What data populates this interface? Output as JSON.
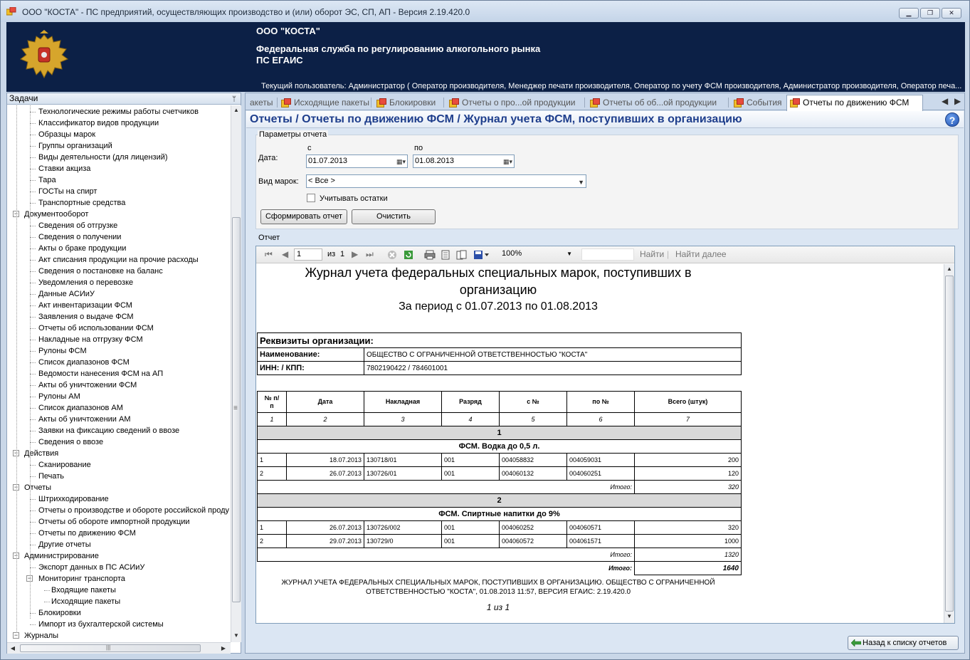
{
  "window": {
    "title": "ООО \"КОСТА\" - ПС предприятий, осуществляющих производство и (или) оборот ЭС, СП, АП - Версия 2.19.420.0",
    "minimize": "▁",
    "maximize": "❐",
    "close": "✕"
  },
  "banner": {
    "org": "ООО \"КОСТА\"",
    "agency_line1": "Федеральная служба по регулированию алкогольного рынка",
    "agency_line2": "ПС ЕГАИС",
    "current_user": "Текущий пользователь: Администратор ( Оператор производителя, Менеджер печати производителя, Оператор по учету ФСМ производителя, Администратор производителя, Оператор печа..."
  },
  "tasks_panel": {
    "title": "Задачи",
    "pin": "ᛘ",
    "items": [
      {
        "label": "Технологические режимы работы счетчиков",
        "level": 2
      },
      {
        "label": "Классификатор видов продукции",
        "level": 2
      },
      {
        "label": "Образцы марок",
        "level": 2
      },
      {
        "label": "Группы организаций",
        "level": 2
      },
      {
        "label": "Виды деятельности (для лицензий)",
        "level": 2
      },
      {
        "label": "Ставки акциза",
        "level": 2
      },
      {
        "label": "Тара",
        "level": 2
      },
      {
        "label": "ГОСТы на спирт",
        "level": 2
      },
      {
        "label": "Транспортные средства",
        "level": 2
      },
      {
        "label": "Документооборот",
        "level": 1
      },
      {
        "label": "Сведения об отгрузке",
        "level": 2
      },
      {
        "label": "Сведения о получении",
        "level": 2
      },
      {
        "label": "Акты о браке продукции",
        "level": 2
      },
      {
        "label": "Акт списания продукции на прочие расходы",
        "level": 2
      },
      {
        "label": "Сведения о постановке на баланс",
        "level": 2
      },
      {
        "label": "Уведомления о перевозке",
        "level": 2
      },
      {
        "label": "Данные АСИиУ",
        "level": 2
      },
      {
        "label": "Акт инвентаризации ФСМ",
        "level": 2
      },
      {
        "label": "Заявления о выдаче ФСМ",
        "level": 2
      },
      {
        "label": "Отчеты об использовании ФСМ",
        "level": 2
      },
      {
        "label": "Накладные на отгрузку ФСМ",
        "level": 2
      },
      {
        "label": "Рулоны ФСМ",
        "level": 2
      },
      {
        "label": "Список диапазонов ФСМ",
        "level": 2
      },
      {
        "label": "Ведомости нанесения ФСМ на АП",
        "level": 2
      },
      {
        "label": "Акты об уничтожении ФСМ",
        "level": 2
      },
      {
        "label": "Рулоны АМ",
        "level": 2
      },
      {
        "label": "Список диапазонов АМ",
        "level": 2
      },
      {
        "label": "Акты об уничтожении АМ",
        "level": 2
      },
      {
        "label": "Заявки на фиксацию сведений о ввозе",
        "level": 2
      },
      {
        "label": "Сведения о ввозе",
        "level": 2
      },
      {
        "label": "Действия",
        "level": 1
      },
      {
        "label": "Сканирование",
        "level": 2
      },
      {
        "label": "Печать",
        "level": 2
      },
      {
        "label": "Отчеты",
        "level": 1
      },
      {
        "label": "Штрихкодирование",
        "level": 2
      },
      {
        "label": "Отчеты о производстве и обороте российской проду",
        "level": 2
      },
      {
        "label": "Отчеты об обороте импортной продукции",
        "level": 2
      },
      {
        "label": "Отчеты по движению ФСМ",
        "level": 2
      },
      {
        "label": "Другие отчеты",
        "level": 2
      },
      {
        "label": "Администрирование",
        "level": 1
      },
      {
        "label": "Экспорт данных в ПС АСИиУ",
        "level": 2
      },
      {
        "label": "Мониторинг транспорта",
        "level": 2,
        "expandable": true
      },
      {
        "label": "Входящие пакеты",
        "level": 3
      },
      {
        "label": "Исходящие пакеты",
        "level": 3
      },
      {
        "label": "Блокировки",
        "level": 2
      },
      {
        "label": "Импорт из бухгалтерской системы",
        "level": 2
      },
      {
        "label": "Журналы",
        "level": 1
      }
    ],
    "scroll_grip": "≡",
    "hscroll_grip": "|||"
  },
  "tabs": [
    {
      "label": "акеты",
      "icon": false
    },
    {
      "label": "Исходящие пакеты",
      "icon": true
    },
    {
      "label": "Блокировки",
      "icon": true
    },
    {
      "label": "Отчеты о про...ой продукции",
      "icon": true
    },
    {
      "label": "Отчеты об об...ой продукции",
      "icon": true
    },
    {
      "label": "События",
      "icon": true
    },
    {
      "label": "Отчеты по движению ФСМ",
      "icon": true,
      "active": true
    }
  ],
  "tab_nav": {
    "prev": "◀",
    "next": "▶"
  },
  "page": {
    "title": "Отчеты / Отчеты по движению ФСМ / Журнал учета ФСМ, поступивших в организацию",
    "help": "?"
  },
  "params": {
    "group_label": "Параметры отчета",
    "date_label": "Дата:",
    "from_label": "с",
    "to_label": "по",
    "from_value": "01.07.2013",
    "to_value": "01.08.2013",
    "mark_type_label": "Вид марок:",
    "mark_type_value": "< Все >",
    "balance_label": "Учитывать остатки",
    "balance_checked": false,
    "build_button": "Сформировать отчет",
    "clear_button": "Очистить"
  },
  "report_group_label": "Отчет",
  "viewer_toolbar": {
    "first": "⏮",
    "prev": "◀",
    "page": "1",
    "of_label": "из",
    "total": "1",
    "next": "▶",
    "last": "⏭",
    "zoom": "100%",
    "find": "Найти",
    "sep": "|",
    "find_next": "Найти далее"
  },
  "report": {
    "title": "Журнал учета федеральных специальных марок, поступивших в организацию",
    "period": "За период с 01.07.2013 по 01.08.2013",
    "org_section": "Реквизиты организации:",
    "name_label": "Наименование:",
    "name_value": "ОБЩЕСТВО С ОГРАНИЧЕННОЙ ОТВЕТСТВЕННОСТЬЮ \"КОСТА\"",
    "inn_label": "ИНН: / КПП:",
    "inn_value": "7802190422 / 784601001",
    "columns": [
      "№ п/п",
      "Дата",
      "Накладная",
      "Разряд",
      "с №",
      "по №",
      "Всего (штук)"
    ],
    "col_numbers": [
      "1",
      "2",
      "3",
      "4",
      "5",
      "6",
      "7"
    ],
    "groups": [
      {
        "number": "1",
        "name": "ФСМ. Водка до 0,5 л.",
        "rows": [
          [
            "1",
            "18.07.2013",
            "130718/01",
            "001",
            "004058832",
            "004059031",
            "200"
          ],
          [
            "2",
            "26.07.2013",
            "130726/01",
            "001",
            "004060132",
            "004060251",
            "120"
          ]
        ],
        "subtotal_label": "Итого:",
        "subtotal": "320"
      },
      {
        "number": "2",
        "name": "ФСМ. Спиртные напитки до 9%",
        "rows": [
          [
            "1",
            "26.07.2013",
            "130726/002",
            "001",
            "004060252",
            "004060571",
            "320"
          ],
          [
            "2",
            "29.07.2013",
            "130729/0",
            "001",
            "004060572",
            "004061571",
            "1000"
          ]
        ],
        "subtotal_label": "Итого:",
        "subtotal": "1320"
      }
    ],
    "total_label": "Итого:",
    "total": "1640",
    "footer": "ЖУРНАЛ УЧЕТА ФЕДЕРАЛЬНЫХ СПЕЦИАЛЬНЫХ МАРОК, ПОСТУПИВШИХ В ОРГАНИЗАЦИЮ. ОБЩЕСТВО С ОГРАНИЧЕННОЙ ОТВЕТСТВЕННОСТЬЮ \"КОСТА\", 01.08.2013 11:57, ВЕРСИЯ ЕГАИС: 2.19.420.0",
    "page_info": "1 из 1"
  },
  "back_button": "Назад к списку отчетов",
  "colors": {
    "banner": "#0c2046",
    "title": "#1e3e8c",
    "panel": "#dbe6f3"
  }
}
